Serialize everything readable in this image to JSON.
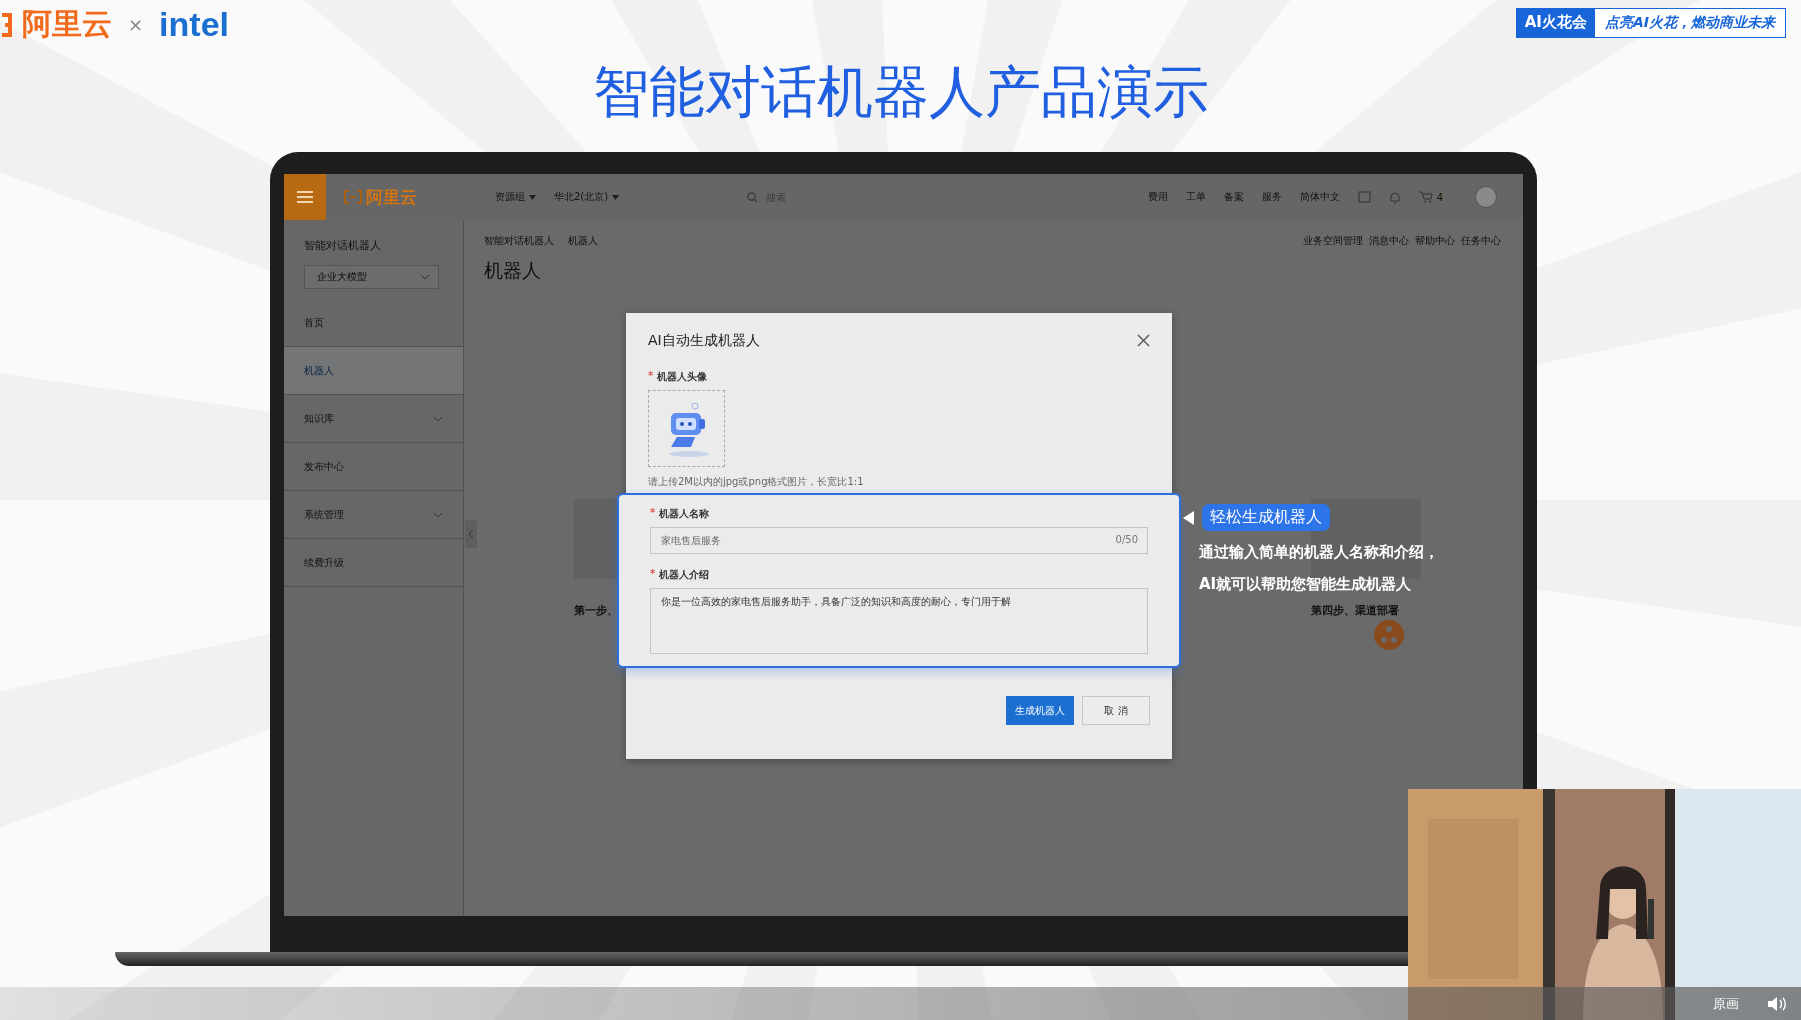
{
  "slide": {
    "brand": "阿里云",
    "separator": "×",
    "partner": "intel",
    "badge": {
      "label": "AI火花会",
      "slogan": "点亮AI火花，燃动商业未来"
    },
    "title": "智能对话机器人产品演示"
  },
  "topbar": {
    "logo": "阿里云",
    "selectors": [
      "资源组",
      "华北2(北京)"
    ],
    "search_placeholder": "搜索",
    "links": [
      "费用",
      "工单",
      "备案",
      "服务",
      "简体中文"
    ],
    "cart_count": "4"
  },
  "sidebar": {
    "title": "智能对话机器人",
    "selector": "企业大模型",
    "items": [
      {
        "label": "首页",
        "kind": "link",
        "selected": false
      },
      {
        "label": "机器人",
        "kind": "link",
        "selected": true
      },
      {
        "label": "知识库",
        "kind": "group",
        "selected": false
      },
      {
        "label": "发布中心",
        "kind": "link",
        "selected": false
      },
      {
        "label": "系统管理",
        "kind": "group",
        "selected": false
      },
      {
        "label": "续费升级",
        "kind": "link",
        "selected": false
      }
    ]
  },
  "main": {
    "breadcrumb": [
      "智能对话机器人",
      "机器人"
    ],
    "heading": "机器人",
    "header_links": [
      "业务空间管理",
      "消息中心",
      "帮助中心",
      "任务中心"
    ],
    "steps": [
      {
        "title": "第一步、"
      },
      {
        "title": "第四步、渠道部署"
      }
    ]
  },
  "dialog": {
    "title": "AI自动生成机器人",
    "avatar_label": {
      "mark": "*",
      "text": "机器人头像"
    },
    "upload_hint": "请上传2M以内的jpg或png格式图片，长宽比1:1",
    "name_label": {
      "mark": "*",
      "text": "机器人名称"
    },
    "name_placeholder": "家电售后服务",
    "counter": "0/50",
    "intro_label": {
      "mark": "*",
      "text": "机器人介绍"
    },
    "intro_value": "你是一位高效的家电售后服务助手，具备广泛的知识和高度的耐心，专门用于解",
    "buttons": [
      {
        "label": "生成机器人",
        "kind": "primary"
      },
      {
        "label": "取 消",
        "kind": "default"
      }
    ]
  },
  "callout": {
    "tag": "轻松生成机器人",
    "lines": [
      "通过输入简单的机器人名称和介绍，",
      "AI就可以帮助您智能生成机器人"
    ]
  },
  "player": {
    "quality": "原画"
  }
}
